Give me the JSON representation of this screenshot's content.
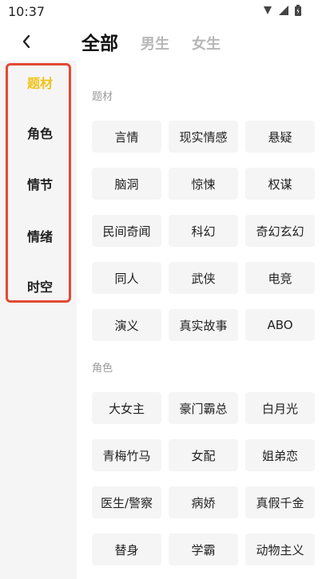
{
  "status_bar": {
    "time": "10:37"
  },
  "header": {
    "tabs": [
      {
        "label": "全部"
      },
      {
        "label": "男生"
      },
      {
        "label": "女生"
      }
    ]
  },
  "sidebar": {
    "items": [
      {
        "label": "题材"
      },
      {
        "label": "角色"
      },
      {
        "label": "情节"
      },
      {
        "label": "情绪"
      },
      {
        "label": "时空"
      }
    ]
  },
  "sections": [
    {
      "title": "题材",
      "tags": [
        "言情",
        "现实情感",
        "悬疑",
        "脑洞",
        "惊悚",
        "权谋",
        "民间奇闻",
        "科幻",
        "奇幻玄幻",
        "同人",
        "武侠",
        "电竞",
        "演义",
        "真实故事",
        "ABO"
      ]
    },
    {
      "title": "角色",
      "tags": [
        "大女主",
        "豪门霸总",
        "白月光",
        "青梅竹马",
        "女配",
        "姐弟恋",
        "医生/警察",
        "病娇",
        "真假千金",
        "替身",
        "学霸",
        "动物主义"
      ]
    }
  ],
  "colors": {
    "accent": "#f1c31a",
    "highlight_border": "#e24a35"
  }
}
